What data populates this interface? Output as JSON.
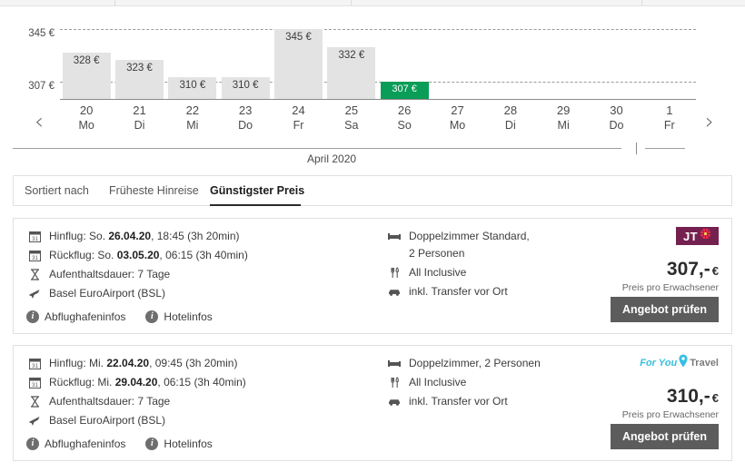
{
  "chart_data": {
    "type": "bar",
    "title": "",
    "xlabel": "",
    "ylabel": "",
    "month_label": "April 2020",
    "axis_ticks": [
      "345 €",
      "307 €"
    ],
    "axis_values": [
      345,
      307
    ],
    "ylim": [
      307,
      345
    ],
    "grid": true,
    "categories": [
      "20",
      "21",
      "22",
      "23",
      "24",
      "25",
      "26",
      "27",
      "28",
      "29",
      "30",
      "1"
    ],
    "weekdays": [
      "Mo",
      "Di",
      "Mi",
      "Do",
      "Fr",
      "Sa",
      "So",
      "Mo",
      "Di",
      "Mi",
      "Do",
      "Fr"
    ],
    "values": [
      328,
      323,
      310,
      310,
      345,
      332,
      307,
      null,
      null,
      null,
      null,
      null
    ],
    "labels": [
      "328 €",
      "323 €",
      "310 €",
      "310 €",
      "345 €",
      "332 €",
      "307 €",
      "",
      "",
      "",
      "",
      ""
    ],
    "cheapest_index": 6,
    "cheapest_color": "#0a9d58",
    "bar_color": "#e3e3e3",
    "prev_arrow": "‹",
    "next_arrow": "›"
  },
  "sortbar": {
    "label": "Sortiert nach",
    "tabs": [
      {
        "label": "Früheste Hinreise",
        "active": false
      },
      {
        "label": "Günstigster Preis",
        "active": true
      }
    ]
  },
  "offers": [
    {
      "flights": [
        {
          "prefix": "Hinflug: So. ",
          "date": "26.04.20",
          "suffix": ", 18:45 (3h 20min)"
        },
        {
          "prefix": "Rückflug: So. ",
          "date": "03.05.20",
          "suffix": ", 06:15 (3h 40min)"
        }
      ],
      "duration": "Aufenthaltsdauer: 7 Tage",
      "airport": "Basel EuroAirport (BSL)",
      "room": "Doppelzimmer Standard,",
      "room_line2": "2 Personen",
      "board": "All Inclusive",
      "transfer": "inkl. Transfer vor Ort",
      "info_links": [
        "Abflughafeninfos",
        "Hotelinfos"
      ],
      "logo_type": "jt",
      "logo_text": "JT",
      "price": "307,-",
      "currency": "€",
      "price_sub": "Preis pro Erwachsener",
      "cta": "Angebot prüfen"
    },
    {
      "flights": [
        {
          "prefix": "Hinflug: Mi. ",
          "date": "22.04.20",
          "suffix": ", 09:45 (3h 20min)"
        },
        {
          "prefix": "Rückflug: Mi. ",
          "date": "29.04.20",
          "suffix": ", 06:15 (3h 40min)"
        }
      ],
      "duration": "Aufenthaltsdauer: 7 Tage",
      "airport": "Basel EuroAirport (BSL)",
      "room": "Doppelzimmer, 2 Personen",
      "room_line2": "",
      "board": "All Inclusive",
      "transfer": "inkl. Transfer vor Ort",
      "info_links": [
        "Abflughafeninfos",
        "Hotelinfos"
      ],
      "logo_type": "fyt",
      "logo_foryou": "For You",
      "logo_travel": "Travel",
      "price": "310,-",
      "currency": "€",
      "price_sub": "Preis pro Erwachsener",
      "cta": "Angebot prüfen"
    }
  ]
}
